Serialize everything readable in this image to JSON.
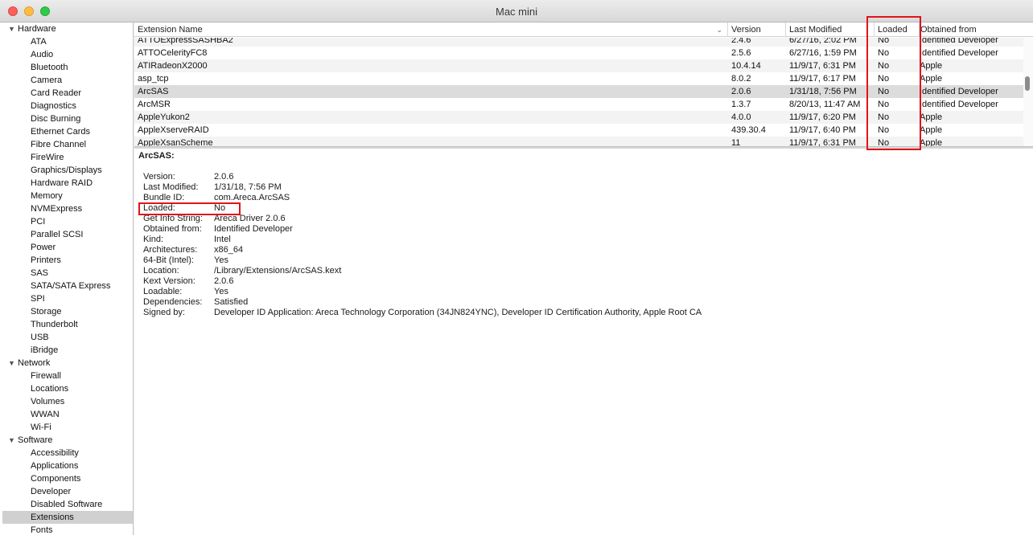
{
  "window": {
    "title": "Mac mini"
  },
  "sidebar": {
    "groups": [
      {
        "label": "Hardware",
        "items": [
          "ATA",
          "Audio",
          "Bluetooth",
          "Camera",
          "Card Reader",
          "Diagnostics",
          "Disc Burning",
          "Ethernet Cards",
          "Fibre Channel",
          "FireWire",
          "Graphics/Displays",
          "Hardware RAID",
          "Memory",
          "NVMExpress",
          "PCI",
          "Parallel SCSI",
          "Power",
          "Printers",
          "SAS",
          "SATA/SATA Express",
          "SPI",
          "Storage",
          "Thunderbolt",
          "USB",
          "iBridge"
        ]
      },
      {
        "label": "Network",
        "items": [
          "Firewall",
          "Locations",
          "Volumes",
          "WWAN",
          "Wi-Fi"
        ]
      },
      {
        "label": "Software",
        "items": [
          "Accessibility",
          "Applications",
          "Components",
          "Developer",
          "Disabled Software",
          "Extensions",
          "Fonts"
        ]
      }
    ],
    "selected": "Extensions"
  },
  "table": {
    "columns": [
      "Extension Name",
      "Version",
      "Last Modified",
      "Loaded",
      "Obtained from"
    ],
    "rows": [
      [
        "ATTOExpressSASHBA2",
        "2.4.6",
        "6/27/16, 2:02 PM",
        "No",
        "Identified Developer"
      ],
      [
        "ATTOCelerityFC8",
        "2.5.6",
        "6/27/16, 1:59 PM",
        "No",
        "Identified Developer"
      ],
      [
        "ATIRadeonX2000",
        "10.4.14",
        "11/9/17, 6:31 PM",
        "No",
        "Apple"
      ],
      [
        "asp_tcp",
        "8.0.2",
        "11/9/17, 6:17 PM",
        "No",
        "Apple"
      ],
      [
        "ArcSAS",
        "2.0.6",
        "1/31/18, 7:56 PM",
        "No",
        "Identified Developer"
      ],
      [
        "ArcMSR",
        "1.3.7",
        "8/20/13, 11:47 AM",
        "No",
        "Identified Developer"
      ],
      [
        "AppleYukon2",
        "4.0.0",
        "11/9/17, 6:20 PM",
        "No",
        "Apple"
      ],
      [
        "AppleXserveRAID",
        "439.30.4",
        "11/9/17, 6:40 PM",
        "No",
        "Apple"
      ],
      [
        "AppleXsanScheme",
        "11",
        "11/9/17, 6:31 PM",
        "No",
        "Apple"
      ]
    ],
    "selected_row": 4
  },
  "detail": {
    "title": "ArcSAS:",
    "fields": [
      [
        "Version:",
        "2.0.6"
      ],
      [
        "Last Modified:",
        "1/31/18, 7:56 PM"
      ],
      [
        "Bundle ID:",
        "com.Areca.ArcSAS"
      ],
      [
        "Loaded:",
        "No"
      ],
      [
        "Get Info String:",
        "Areca Driver 2.0.6"
      ],
      [
        "Obtained from:",
        "Identified Developer"
      ],
      [
        "Kind:",
        "Intel"
      ],
      [
        "Architectures:",
        "x86_64"
      ],
      [
        "64-Bit (Intel):",
        "Yes"
      ],
      [
        "Location:",
        "/Library/Extensions/ArcSAS.kext"
      ],
      [
        "Kext Version:",
        "2.0.6"
      ],
      [
        "Loadable:",
        "Yes"
      ],
      [
        "Dependencies:",
        "Satisfied"
      ],
      [
        "Signed by:",
        "Developer ID Application: Areca Technology Corporation (34JN824YNC), Developer ID Certification Authority, Apple Root CA"
      ]
    ]
  },
  "icons": {
    "disclosure": "disclosure-triangle-icon",
    "sort": "chevron-down-icon"
  },
  "colors": {
    "annotation": "#e0141a",
    "selection": "#d0d0d0"
  }
}
